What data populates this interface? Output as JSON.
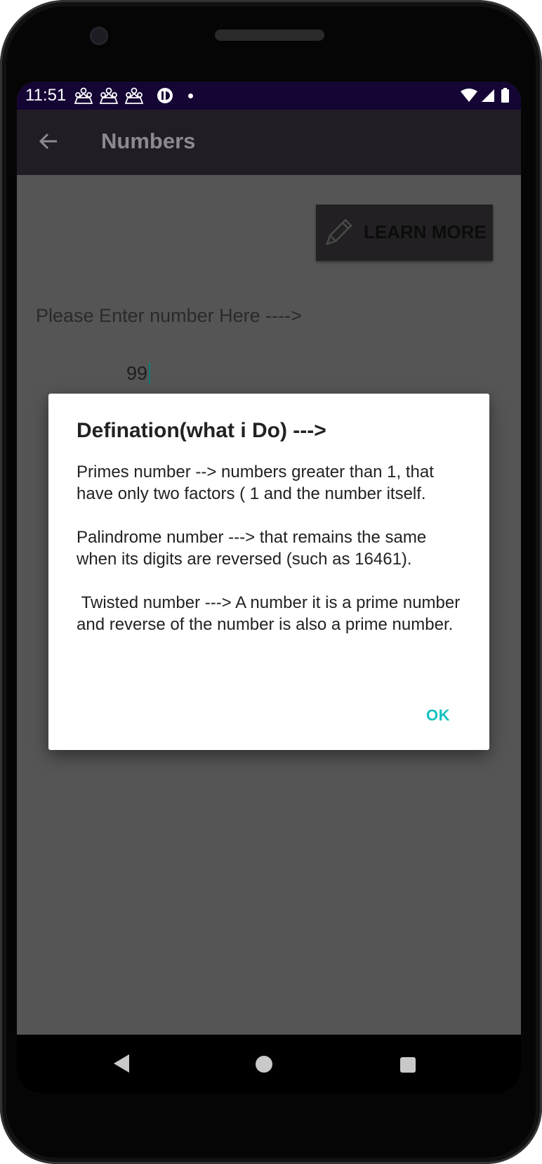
{
  "status_bar": {
    "time": "11:51",
    "notification_icons": [
      "people-icon",
      "people-icon",
      "people-icon",
      "cc-icon"
    ],
    "system_icons": [
      "wifi-icon",
      "signal-icon",
      "battery-icon"
    ]
  },
  "app_bar": {
    "title": "Numbers",
    "back_icon": "arrow-back-icon"
  },
  "content": {
    "learn_more_label": "LEARN MORE",
    "learn_more_icon": "pencil-icon",
    "prompt": "Please Enter number Here ---->",
    "entered_value": "99"
  },
  "dialog": {
    "title": "Defination(what i Do) --->",
    "body": "Primes number --> numbers greater than 1, that have only two factors ( 1 and the number itself.\n\nPalindrome number ---> that remains the same when its digits are reversed (such as 16461).\n\n Twisted number ---> A number it is a prime number and reverse of the number is also a prime number.",
    "ok_label": "OK"
  },
  "nav_bar": {
    "icons": [
      "nav-back-icon",
      "nav-home-icon",
      "nav-recents-icon"
    ]
  },
  "colors": {
    "status_bar": "#150534",
    "app_bar": "#221d24",
    "scrim": "#555555",
    "accent": "#14c2c0"
  }
}
